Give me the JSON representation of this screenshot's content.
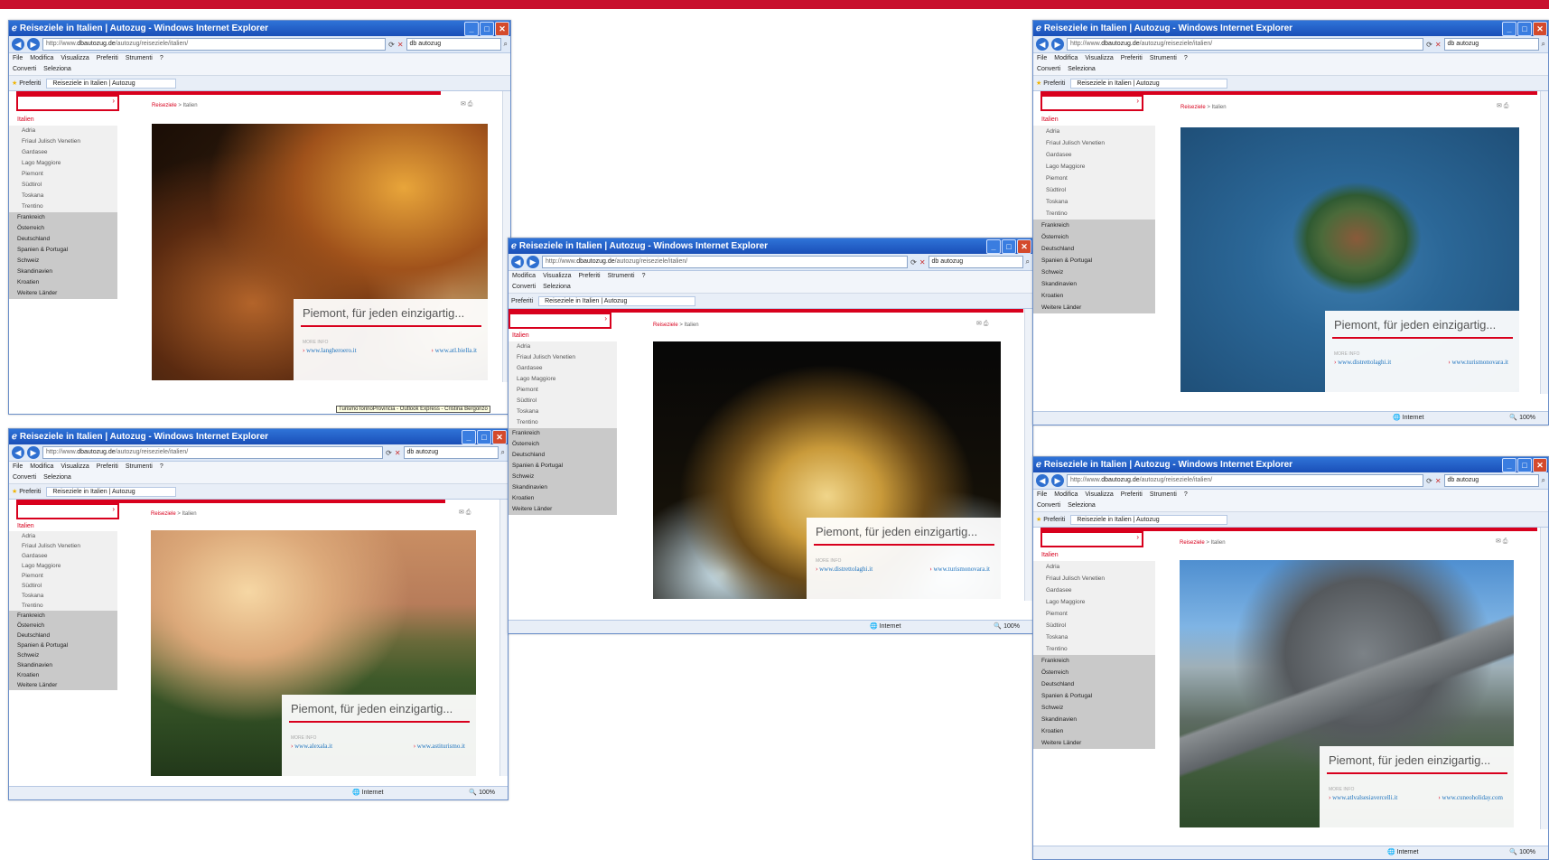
{
  "window": {
    "title": "Reiseziele in Italien | Autozug - Windows Internet Explorer",
    "url_prefix": "http://www.",
    "url_domain": "dbautozug.de",
    "url_path": "/autozug/reiseziele/italien/",
    "search_text": "db autozug",
    "menu": [
      "File",
      "Modifica",
      "Visualizza",
      "Preferiti",
      "Strumenti",
      "?"
    ],
    "links": [
      "Converti",
      "Seleziona"
    ],
    "favorites_label": "Preferiti",
    "tab_label": "Reiseziele in Italien | Autozug",
    "status_zone": "Internet",
    "zoom": "100%",
    "tooltip": "TurismoTorinoProvincia - Outlook Express - Cristina Bergonzo"
  },
  "site": {
    "breadcrumb_root": "Reiseziele",
    "breadcrumb_sep": " > ",
    "breadcrumb_current": "Italien",
    "search_go": "›",
    "sidebar_head": "Italien",
    "sidebar_sub": [
      "Adria",
      "Friaul Julisch Venetien",
      "Gardasee",
      "Lago Maggiore",
      "Piemont",
      "Südtirol",
      "Toskana",
      "Trentino"
    ],
    "sidebar_main": [
      "Frankreich",
      "Österreich",
      "Deutschland",
      "Spanien & Portugal",
      "Schweiz",
      "Skandinavien",
      "Kroatien",
      "Weitere Länder"
    ],
    "caption_title": "Piemont, für jeden einzigartig...",
    "more_info": "MORE INFO",
    "arrow": "›"
  },
  "screens": [
    {
      "name": "food",
      "links": [
        "www.langheroero.it",
        "www.atl.biella.it"
      ]
    },
    {
      "name": "vineyard",
      "links": [
        "www.alexala.it",
        "www.astiturismo.it"
      ]
    },
    {
      "name": "palace",
      "links": [
        "www.distrettolaghi.it",
        "www.turismonovara.it"
      ]
    },
    {
      "name": "island",
      "links": [
        "www.distrettolaghi.it",
        "www.turismonovara.it"
      ]
    },
    {
      "name": "mountain",
      "links": [
        "www.atlvalsesiavercelli.it",
        "www.cuneoholiday.com"
      ]
    }
  ],
  "colors": {
    "accent": "#d8001d",
    "topline": "#c8102e",
    "ie_blue": "#1a4fb7",
    "link": "#1e73be"
  }
}
